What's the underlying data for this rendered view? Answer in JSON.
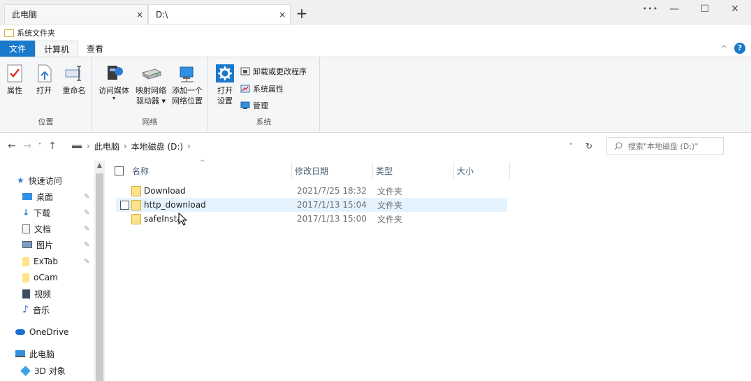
{
  "tabs": [
    {
      "title": "此电脑",
      "close": "×"
    },
    {
      "title": "D:\\",
      "close": "×"
    }
  ],
  "newtab": "+",
  "window_controls": {
    "more": "•••",
    "minimize": "—",
    "maximize": "☐",
    "close": "✕"
  },
  "qat_label": "系统文件夹",
  "ribbon_tabs": {
    "file": "文件",
    "computer": "计算机",
    "view": "查看"
  },
  "help": "?",
  "collapse": "^",
  "ribbon": {
    "location": {
      "label": "位置",
      "buttons": [
        "属性",
        "打开",
        "重命名"
      ]
    },
    "network": {
      "label": "网络",
      "access_media": "访问媒体",
      "map_drive_1": "映射网络",
      "map_drive_2": "驱动器 ▾",
      "add_location_1": "添加一个",
      "add_location_2": "网络位置"
    },
    "system": {
      "label": "系统",
      "open_settings_1": "打开",
      "open_settings_2": "设置",
      "uninstall": "卸载或更改程序",
      "sysprops": "系统属性",
      "manage": "管理"
    }
  },
  "nav": {
    "back": "←",
    "forward": "→",
    "recent": "˅",
    "up": "↑"
  },
  "breadcrumb": [
    "此电脑",
    "本地磁盘 (D:)"
  ],
  "breadcrumb_sep": "›",
  "address_dropdown": "˅",
  "refresh": "↻",
  "search_placeholder": "搜索\"本地磁盘 (D:)\"",
  "navpane": {
    "quick_access": "快速访问",
    "items": [
      {
        "label": "桌面",
        "pinned": true
      },
      {
        "label": "下载",
        "pinned": true
      },
      {
        "label": "文档",
        "pinned": true
      },
      {
        "label": "图片",
        "pinned": true
      },
      {
        "label": "ExTab",
        "pinned": true
      },
      {
        "label": "oCam",
        "pinned": false
      },
      {
        "label": "视频",
        "pinned": false
      },
      {
        "label": "音乐",
        "pinned": false
      }
    ],
    "onedrive": "OneDrive",
    "this_pc": "此电脑",
    "objects3d": "3D 对象"
  },
  "columns": {
    "name": "名称",
    "modified": "修改日期",
    "type": "类型",
    "size": "大小"
  },
  "files": [
    {
      "name": "Download",
      "modified": "2021/7/25 18:32",
      "type": "文件夹"
    },
    {
      "name": "http_download",
      "modified": "2017/1/13 15:04",
      "type": "文件夹"
    },
    {
      "name": "safeInsta",
      "modified": "2017/1/13 15:00",
      "type": "文件夹"
    }
  ],
  "colors": {
    "accent": "#1979ca",
    "hover_row": "#e5f3ff",
    "folder": "#fde38a"
  }
}
